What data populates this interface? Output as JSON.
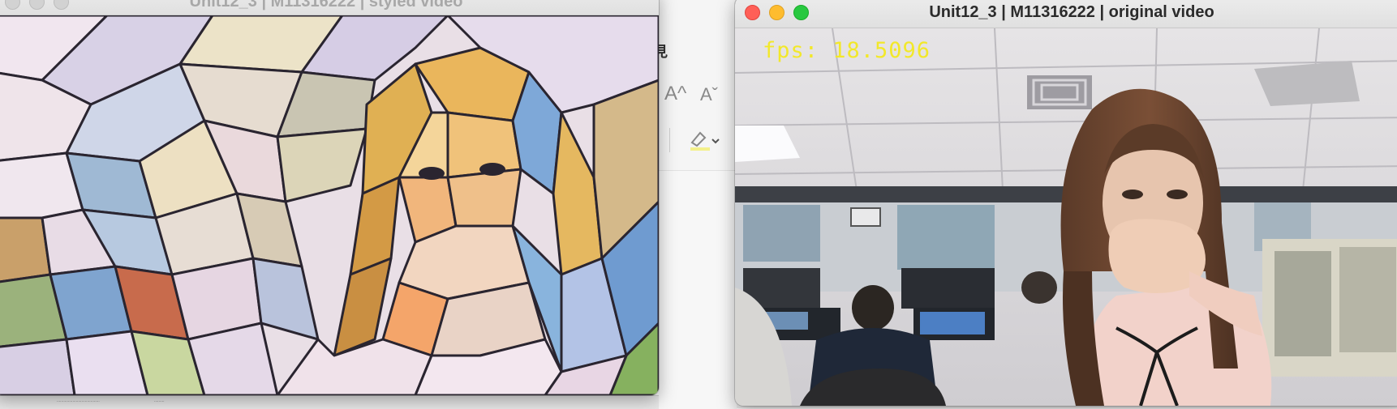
{
  "windows": {
    "styled": {
      "title": "Unit12_3 | M11316222 | styled video"
    },
    "original": {
      "title": "Unit12_3 | M11316222 | original video",
      "overlay": {
        "fps_text": "fps: 18.5096",
        "color": "#f2e82a"
      }
    }
  },
  "background_app": {
    "partial_glyph": "見",
    "font_increase_label": "A^",
    "font_decrease_label": "Aˇ"
  },
  "colors": {
    "close": "#ff5f57",
    "minimize": "#febc2e",
    "zoom": "#28c840",
    "inactive_control": "#d2d2d2"
  }
}
